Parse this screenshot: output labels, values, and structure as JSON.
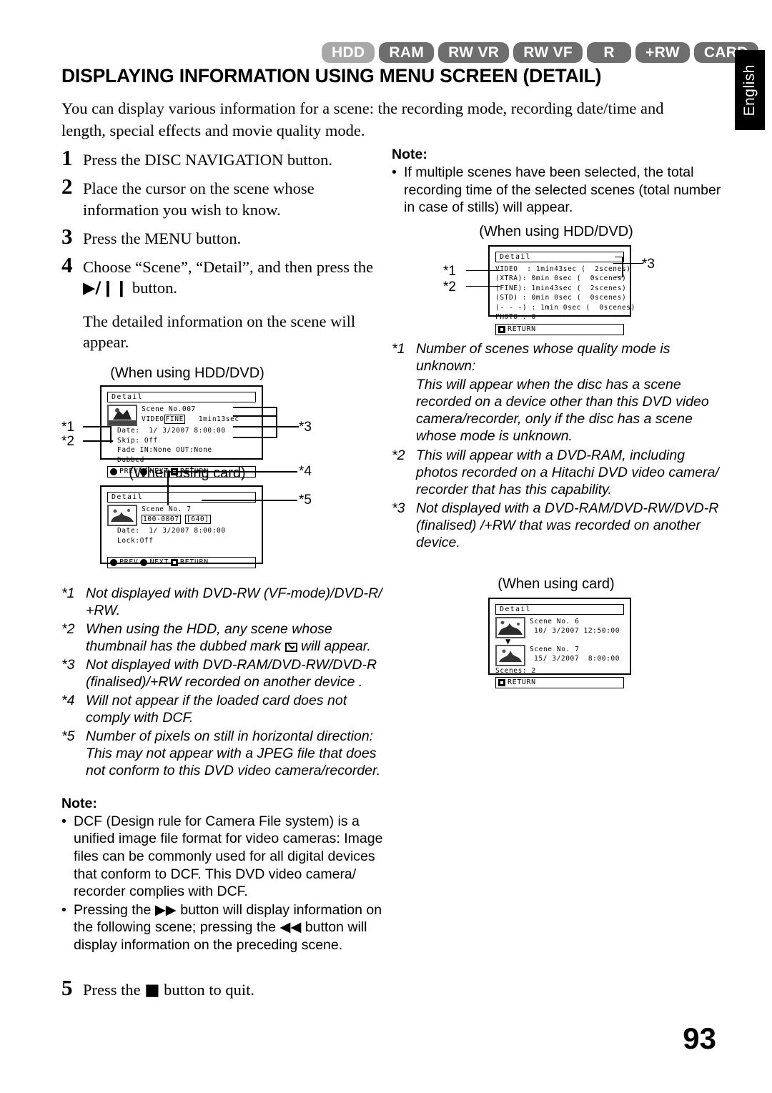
{
  "header": {
    "badges": [
      {
        "label": "HDD",
        "state": "dim"
      },
      {
        "label": "RAM",
        "state": "on"
      },
      {
        "label": "RW VR",
        "state": "on"
      },
      {
        "label": "RW VF",
        "state": "on"
      },
      {
        "label": "R",
        "state": "on"
      },
      {
        "label": "+RW",
        "state": "on"
      },
      {
        "label": "CARD",
        "state": "on"
      }
    ],
    "language_tab": "English",
    "title": "DISPLAYING INFORMATION USING MENU SCREEN (DETAIL)",
    "intro": "You can display various information for a scene: the recording mode, recording date/time and length, special effects and movie quality mode."
  },
  "steps": [
    {
      "num": "1",
      "text": "Press the DISC NAVIGATION button."
    },
    {
      "num": "2",
      "text": "Place the cursor on the scene whose information you wish to know."
    },
    {
      "num": "3",
      "text": "Press the MENU button."
    },
    {
      "num": "4",
      "text_before": "Choose “Scene”, “Detail”, and then press the ",
      "glyph": "▶/❙❙",
      "text_after": " button."
    },
    {
      "num": "5",
      "text_before": "Press the ",
      "glyph": "■",
      "text_after": " button to quit."
    }
  ],
  "step4_result": "The detailed information on the scene will appear.",
  "left_screens": {
    "caption_hdd": "(When using HDD/DVD)",
    "caption_card": "(When using card)",
    "hdd_detail": {
      "title": "Detail",
      "scene_no": "Scene No.007",
      "video_label": "VIDEO",
      "video_mode": "FINE",
      "video_length": "1min13sec",
      "date": "Date:  1/ 3/2007 8:00:00",
      "skip": "Skip: Off",
      "fade": "Fade IN:None OUT:None",
      "dubbed": "Dubbed",
      "bottom": [
        "PREV",
        "NEXT",
        "RETURN"
      ]
    },
    "card_detail": {
      "title": "Detail",
      "scene_no": "Scene No. 7",
      "file_no": "100-0007",
      "pixels": "[640]",
      "date": "Date:  1/ 3/2007 8:00:00",
      "lock": "Lock:Off",
      "bottom": [
        "PREV",
        "NEXT",
        "RETURN"
      ]
    },
    "callouts": [
      "*1",
      "*2",
      "*3",
      "*4",
      "*5"
    ]
  },
  "left_footnotes": [
    {
      "mark": "*1",
      "text": "Not displayed with DVD-RW (VF-mode)/DVD-R/ +RW."
    },
    {
      "mark": "*2",
      "text_a": "When using the HDD, any scene whose thumbnail has the dubbed mark ",
      "icon": "dubbed-mark",
      "text_b": " will appear."
    },
    {
      "mark": "*3",
      "text": "Not displayed with DVD-RAM/DVD-RW/DVD-R (finalised)/+RW recorded on another device ."
    },
    {
      "mark": "*4",
      "text": "Will not appear if the loaded card does not comply with DCF."
    },
    {
      "mark": "*5",
      "text": "Number of pixels on still in horizontal direction: This may not appear with a JPEG file that does not conform to this DVD video camera/recorder."
    }
  ],
  "left_note": {
    "heading": "Note:",
    "items": [
      {
        "text": "DCF (Design rule for Camera File system) is a unified image file format for video cameras: Image files can be commonly used for all digital devices that conform to DCF. This DVD video camera/ recorder complies with DCF."
      },
      {
        "text_a": "Pressing the ",
        "glyph_a": "▶▶",
        "text_b": " button will display information on the following scene; pressing the ",
        "glyph_b": "◀◀",
        "text_c": " button will display information on the preceding scene."
      }
    ]
  },
  "right_note": {
    "heading": "Note:",
    "items": [
      {
        "text": "If multiple scenes have been selected, the total recording time of the selected scenes (total number in case of stills) will appear."
      }
    ]
  },
  "right_screens": {
    "caption_hdd": "(When using HDD/DVD)",
    "caption_card": "(When using card)",
    "hdd_total": {
      "title": "Detail",
      "rows": [
        "VIDEO  : 1min43sec (  2scenes)",
        "(XTRA): 0min 0sec (  0scenes)",
        "(FINE): 1min43sec (  2scenes)",
        "(STD) : 0min 0sec (  0scenes)",
        "(- - -) : 1min 0sec (  0scenes)",
        "PHOTO : 0"
      ],
      "bottom": [
        "RETURN"
      ]
    },
    "card_total": {
      "title": "Detail",
      "scene1_no": "Scene No. 6",
      "scene1_date": "10/ 3/2007 12:50:00",
      "scene2_no": "Scene No. 7",
      "scene2_date": "15/ 3/2007  8:00:00",
      "scenes_count": "Scenes: 2",
      "bottom": [
        "RETURN"
      ]
    },
    "callouts": [
      "*1",
      "*2",
      "*3"
    ]
  },
  "right_footnotes": [
    {
      "mark": "*1",
      "text": "Number of scenes whose quality mode is unknown:",
      "cont": "This will appear when the disc has a scene recorded on a device other than this DVD video camera/recorder, only if the disc has a scene whose mode is unknown."
    },
    {
      "mark": "*2",
      "text": "This will appear with a DVD-RAM, including photos recorded on a Hitachi DVD video camera/ recorder that has this capability."
    },
    {
      "mark": "*3",
      "text": "Not displayed with a DVD-RAM/DVD-RW/DVD-R (finalised) /+RW that was recorded on another device."
    }
  ],
  "footer": {
    "page_number": "93"
  }
}
